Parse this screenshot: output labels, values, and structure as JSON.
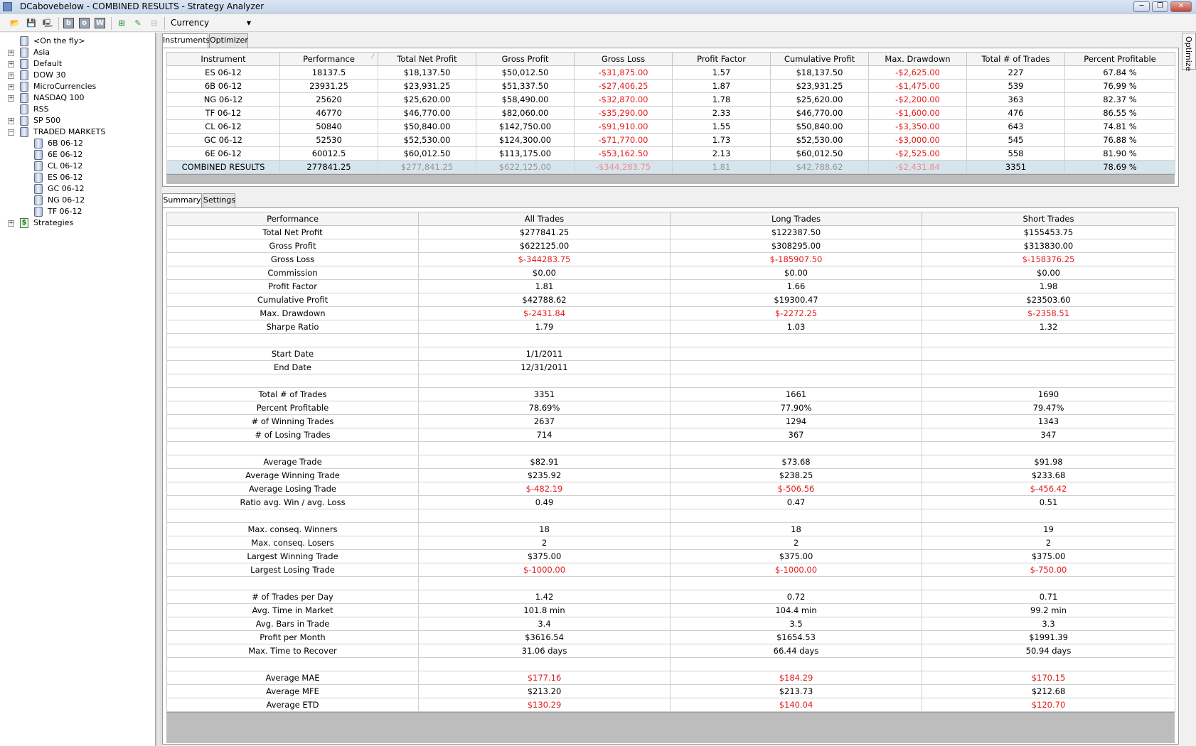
{
  "window": {
    "title": "DCabovebelow - COMBINED RESULTS - Strategy Analyzer",
    "minimize": "─",
    "maximize": "❐",
    "close": "✕"
  },
  "toolbar": {
    "currency": "Currency",
    "b_label": "b",
    "o_label": "o",
    "w_label": "W"
  },
  "sidebar": {
    "items": [
      {
        "label": "<On the fly>",
        "level": 0,
        "expand": "",
        "icon": "db"
      },
      {
        "label": "Asia",
        "level": 0,
        "expand": "+",
        "icon": "db"
      },
      {
        "label": "Default",
        "level": 0,
        "expand": "+",
        "icon": "db"
      },
      {
        "label": "DOW 30",
        "level": 0,
        "expand": "+",
        "icon": "db"
      },
      {
        "label": "MicroCurrencies",
        "level": 0,
        "expand": "+",
        "icon": "db"
      },
      {
        "label": "NASDAQ 100",
        "level": 0,
        "expand": "+",
        "icon": "db"
      },
      {
        "label": "RSS",
        "level": 0,
        "expand": "",
        "icon": "db"
      },
      {
        "label": "SP 500",
        "level": 0,
        "expand": "+",
        "icon": "db"
      },
      {
        "label": "TRADED MARKETS",
        "level": 0,
        "expand": "−",
        "icon": "db"
      },
      {
        "label": "6B 06-12",
        "level": 1,
        "expand": "",
        "icon": "db"
      },
      {
        "label": "6E 06-12",
        "level": 1,
        "expand": "",
        "icon": "db"
      },
      {
        "label": "CL 06-12",
        "level": 1,
        "expand": "",
        "icon": "db"
      },
      {
        "label": "ES 06-12",
        "level": 1,
        "expand": "",
        "icon": "db"
      },
      {
        "label": "GC 06-12",
        "level": 1,
        "expand": "",
        "icon": "db"
      },
      {
        "label": "NG 06-12",
        "level": 1,
        "expand": "",
        "icon": "db"
      },
      {
        "label": "TF 06-12",
        "level": 1,
        "expand": "",
        "icon": "db"
      },
      {
        "label": "Strategies",
        "level": 0,
        "expand": "+",
        "icon": "dollar"
      }
    ]
  },
  "optimize_tab": "Optimize",
  "top_tabs": [
    "Instruments",
    "Optimizer"
  ],
  "instruments": {
    "columns": [
      "Instrument",
      "Performance",
      "Total Net Profit",
      "Gross Profit",
      "Gross Loss",
      "Profit Factor",
      "Cumulative Profit",
      "Max. Drawdown",
      "Total # of Trades",
      "Percent Profitable"
    ],
    "sort_indicator": "⁄",
    "rows": [
      [
        "ES 06-12",
        "18137.5",
        "$18,137.50",
        "$50,012.50",
        "-$31,875.00",
        "1.57",
        "$18,137.50",
        "-$2,625.00",
        "227",
        "67.84 %"
      ],
      [
        "6B 06-12",
        "23931.25",
        "$23,931.25",
        "$51,337.50",
        "-$27,406.25",
        "1.87",
        "$23,931.25",
        "-$1,475.00",
        "539",
        "76.99 %"
      ],
      [
        "NG 06-12",
        "25620",
        "$25,620.00",
        "$58,490.00",
        "-$32,870.00",
        "1.78",
        "$25,620.00",
        "-$2,200.00",
        "363",
        "82.37 %"
      ],
      [
        "TF 06-12",
        "46770",
        "$46,770.00",
        "$82,060.00",
        "-$35,290.00",
        "2.33",
        "$46,770.00",
        "-$1,600.00",
        "476",
        "86.55 %"
      ],
      [
        "CL 06-12",
        "50840",
        "$50,840.00",
        "$142,750.00",
        "-$91,910.00",
        "1.55",
        "$50,840.00",
        "-$3,350.00",
        "643",
        "74.81 %"
      ],
      [
        "GC 06-12",
        "52530",
        "$52,530.00",
        "$124,300.00",
        "-$71,770.00",
        "1.73",
        "$52,530.00",
        "-$3,000.00",
        "545",
        "76.88 %"
      ],
      [
        "6E 06-12",
        "60012.5",
        "$60,012.50",
        "$113,175.00",
        "-$53,162.50",
        "2.13",
        "$60,012.50",
        "-$2,525.00",
        "558",
        "81.90 %"
      ]
    ],
    "combined": [
      "COMBINED RESULTS",
      "277841.25",
      "$277,841.25",
      "$622,125.00",
      "-$344,283.75",
      "1.81",
      "$42,788.62",
      "-$2,431.84",
      "3351",
      "78.69 %"
    ]
  },
  "bottom_tabs": [
    "Summary",
    "Settings"
  ],
  "summary": {
    "columns": [
      "Performance",
      "All Trades",
      "Long Trades",
      "Short Trades"
    ],
    "rows": [
      [
        "Total Net Profit",
        "$277841.25",
        "$122387.50",
        "$155453.75"
      ],
      [
        "Gross Profit",
        "$622125.00",
        "$308295.00",
        "$313830.00"
      ],
      [
        "Gross Loss",
        "$-344283.75",
        "$-185907.50",
        "$-158376.25"
      ],
      [
        "Commission",
        "$0.00",
        "$0.00",
        "$0.00"
      ],
      [
        "Profit Factor",
        "1.81",
        "1.66",
        "1.98"
      ],
      [
        "Cumulative Profit",
        "$42788.62",
        "$19300.47",
        "$23503.60"
      ],
      [
        "Max. Drawdown",
        "$-2431.84",
        "$-2272.25",
        "$-2358.51"
      ],
      [
        "Sharpe Ratio",
        "1.79",
        "1.03",
        "1.32"
      ],
      [
        "",
        "",
        "",
        ""
      ],
      [
        "Start Date",
        "1/1/2011",
        "",
        ""
      ],
      [
        "End Date",
        "12/31/2011",
        "",
        ""
      ],
      [
        "",
        "",
        "",
        ""
      ],
      [
        "Total # of Trades",
        "3351",
        "1661",
        "1690"
      ],
      [
        "Percent Profitable",
        "78.69%",
        "77.90%",
        "79.47%"
      ],
      [
        "# of Winning Trades",
        "2637",
        "1294",
        "1343"
      ],
      [
        "# of Losing Trades",
        "714",
        "367",
        "347"
      ],
      [
        "",
        "",
        "",
        ""
      ],
      [
        "Average Trade",
        "$82.91",
        "$73.68",
        "$91.98"
      ],
      [
        "Average Winning Trade",
        "$235.92",
        "$238.25",
        "$233.68"
      ],
      [
        "Average Losing Trade",
        "$-482.19",
        "$-506.56",
        "$-456.42"
      ],
      [
        "Ratio avg. Win / avg. Loss",
        "0.49",
        "0.47",
        "0.51"
      ],
      [
        "",
        "",
        "",
        ""
      ],
      [
        "Max. conseq. Winners",
        "18",
        "18",
        "19"
      ],
      [
        "Max. conseq. Losers",
        "2",
        "2",
        "2"
      ],
      [
        "Largest Winning Trade",
        "$375.00",
        "$375.00",
        "$375.00"
      ],
      [
        "Largest Losing Trade",
        "$-1000.00",
        "$-1000.00",
        "$-750.00"
      ],
      [
        "",
        "",
        "",
        ""
      ],
      [
        "# of Trades per Day",
        "1.42",
        "0.72",
        "0.71"
      ],
      [
        "Avg. Time in Market",
        "101.8 min",
        "104.4 min",
        "99.2 min"
      ],
      [
        "Avg. Bars in Trade",
        "3.4",
        "3.5",
        "3.3"
      ],
      [
        "Profit per Month",
        "$3616.54",
        "$1654.53",
        "$1991.39"
      ],
      [
        "Max. Time to Recover",
        "31.06 days",
        "66.44 days",
        "50.94 days"
      ],
      [
        "",
        "",
        "",
        ""
      ],
      [
        "Average MAE",
        "$177.16",
        "$184.29",
        "$170.15"
      ],
      [
        "Average MFE",
        "$213.20",
        "$213.73",
        "$212.68"
      ],
      [
        "Average ETD",
        "$130.29",
        "$140.04",
        "$120.70"
      ]
    ],
    "red_rows": [
      2,
      6,
      19,
      25,
      33,
      35
    ]
  },
  "colors": {
    "negative": "#e41b1b",
    "combined_row": "#d6e5ed",
    "gray_area": "#bdbdbd"
  }
}
